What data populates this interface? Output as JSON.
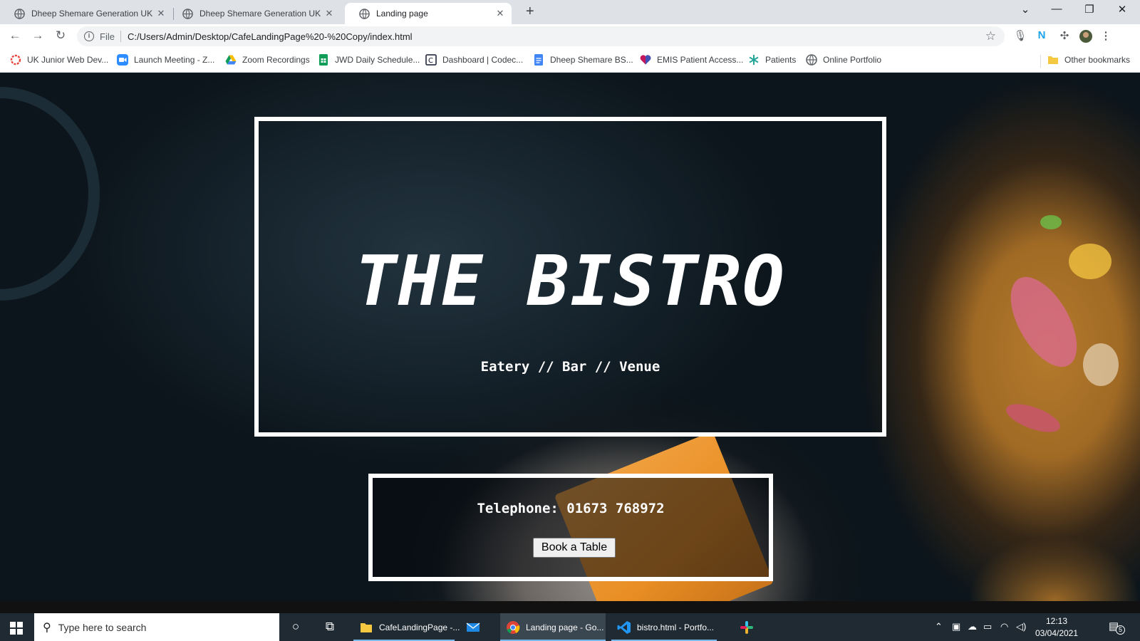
{
  "browser": {
    "tabs": [
      {
        "label": "Dheep Shemare Generation UK P",
        "active": false
      },
      {
        "label": "Dheep Shemare Generation UK P",
        "active": false
      },
      {
        "label": "Landing page",
        "active": true
      }
    ],
    "new_tab_symbol": "+",
    "address": {
      "scheme": "File",
      "url": "C:/Users/Admin/Desktop/CafeLandingPage%20-%20Copy/index.html"
    },
    "bookmarks": [
      {
        "label": "UK Junior Web Dev...",
        "icon": "ring-icon",
        "color": "#e8453c"
      },
      {
        "label": "Launch Meeting - Z...",
        "icon": "zoom-icon",
        "color": "#2d8cff"
      },
      {
        "label": "Zoom Recordings",
        "icon": "drive-icon",
        "color": "#fbbc04"
      },
      {
        "label": "JWD Daily Schedule...",
        "icon": "sheets-icon",
        "color": "#0f9d58"
      },
      {
        "label": "Dashboard | Codec...",
        "icon": "codecademy-icon",
        "color": "#10162f"
      },
      {
        "label": "Dheep Shemare BS...",
        "icon": "docs-icon",
        "color": "#4285f4"
      },
      {
        "label": "EMIS Patient Access...",
        "icon": "heart-icon",
        "color": "#c2185b"
      },
      {
        "label": "Patients",
        "icon": "snowflake-icon",
        "color": "#26a69a"
      },
      {
        "label": "Online Portfolio",
        "icon": "globe-icon",
        "color": "#5f6368"
      }
    ],
    "other_bookmarks": "Other bookmarks"
  },
  "page": {
    "title": "THE BISTRO",
    "subtitle": "Eatery // Bar // Venue",
    "phone": "Telephone: 01673 768972",
    "book_button": "Book a Table"
  },
  "taskbar": {
    "search_placeholder": "Type here to search",
    "apps": [
      {
        "label": "CafeLandingPage -...",
        "icon": "folder-icon",
        "color": "#f5c842"
      },
      {
        "label": "",
        "icon": "mail-icon",
        "color": "#1e88e5"
      },
      {
        "label": "Landing page - Go...",
        "icon": "chrome-icon",
        "color": "#db4437"
      },
      {
        "label": "bistro.html - Portfo...",
        "icon": "vscode-icon",
        "color": "#2196f3"
      },
      {
        "label": "",
        "icon": "slack-icon",
        "color": "#e01e5a"
      }
    ],
    "time": "12:13",
    "date": "03/04/2021",
    "notification_count": "5"
  },
  "colors": {
    "tab_strip": "#dee1e6",
    "taskbar": "#1f2a33",
    "page_dark": "#0f1a21",
    "frame_white": "#ffffff"
  }
}
